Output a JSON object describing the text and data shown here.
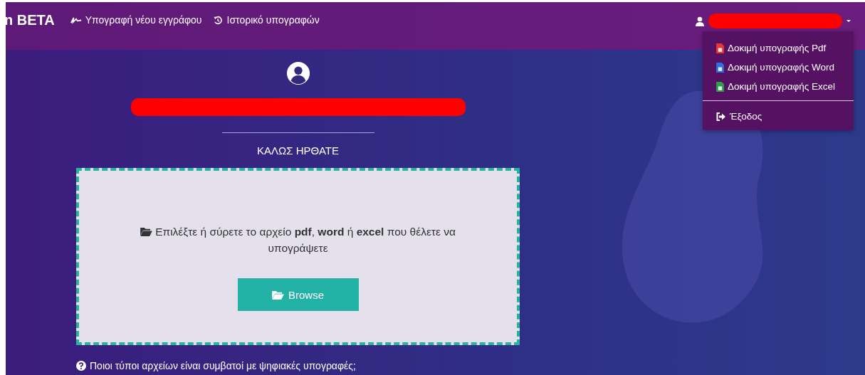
{
  "navbar": {
    "brand": "n BETA",
    "links": [
      {
        "kind": "signature",
        "label": "Υπογραφή νέου εγγράφου"
      },
      {
        "kind": "history",
        "label": "Ιστορικό υπογραφών"
      }
    ]
  },
  "user_menu": {
    "expanded": true,
    "items": [
      {
        "kind": "pdf",
        "label": "Δοκιμή υπογραφής Pdf"
      },
      {
        "kind": "word",
        "label": "Δοκιμή υπογραφής Word"
      },
      {
        "kind": "excel",
        "label": "Δοκιμή υπογραφής Excel"
      },
      {
        "kind": "logout",
        "label": "Έξοδος"
      }
    ]
  },
  "profile": {
    "greeting": "ΚΑΛΩΣ ΗΡΘΑΤΕ"
  },
  "dropzone": {
    "instruction": "Επιλέξτε ή σύρετε το αρχείο **pdf**, **word** ή **excel** που θέλετε να υπογράψετε",
    "button": "Browse"
  },
  "help_link": "Ποιοι τύποι αρχείων είναι συμβατοί με ψηφιακές υπογραφές;"
}
